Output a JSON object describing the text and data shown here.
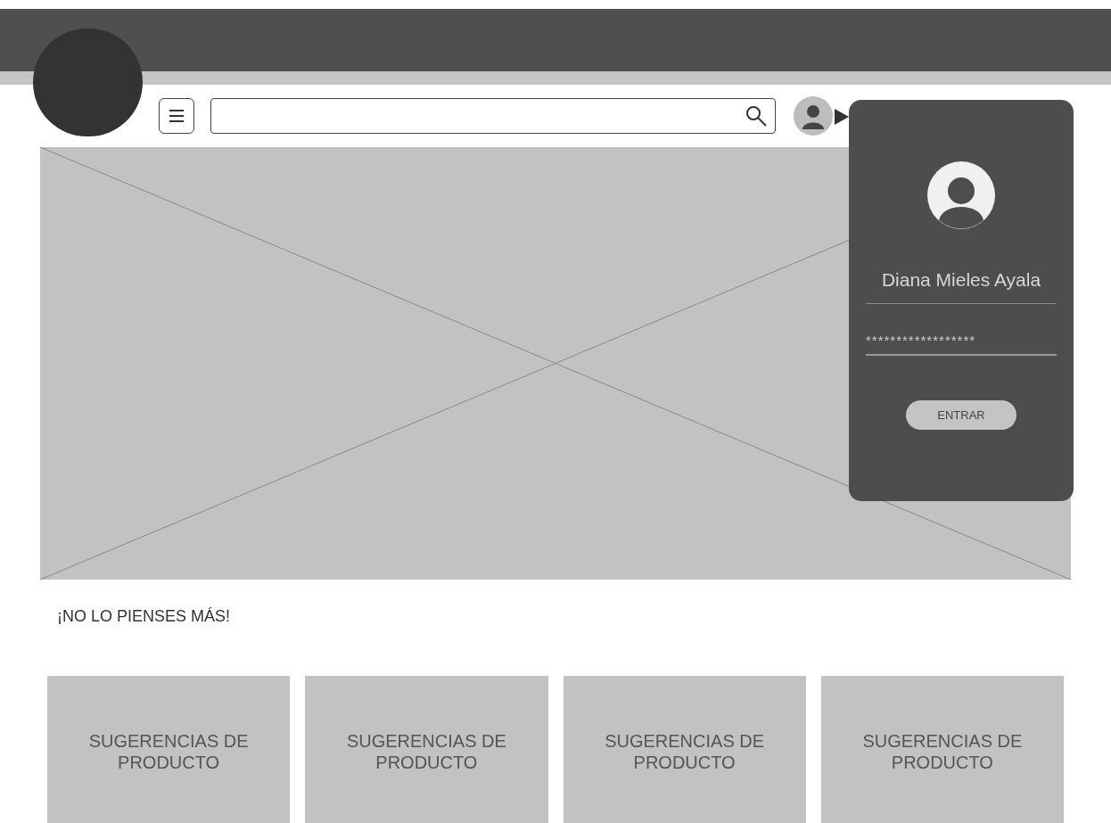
{
  "login_popup": {
    "username": "Diana Mieles Ayala",
    "password": "******************",
    "button": "ENTRAR"
  },
  "section_title": "¡NO LO PIENSES MÁS!",
  "cards": [
    "SUGERENCIAS DE PRODUCTO",
    "SUGERENCIAS DE PRODUCTO",
    "SUGERENCIAS DE PRODUCTO",
    "SUGERENCIAS DE PRODUCTO"
  ]
}
